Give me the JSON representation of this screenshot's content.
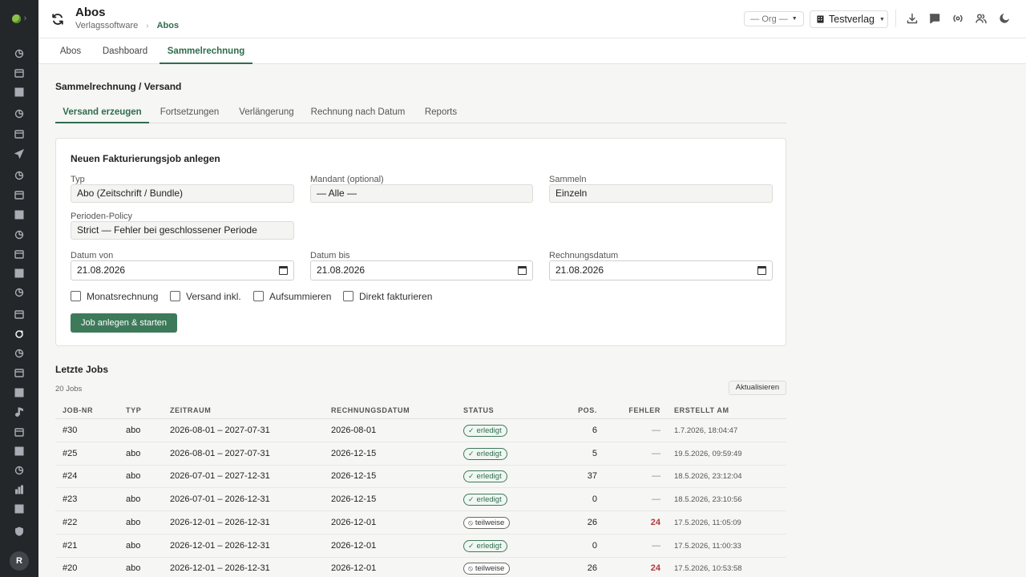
{
  "sidebar": {
    "chevron": "›",
    "items": [
      "chart-pie-icon",
      "calendar-icon",
      "dashboard-icon",
      "users-edit-icon",
      "inbox-icon",
      "send-icon",
      "lightbulb-icon",
      "books-icon",
      "image-icon",
      "briefcase-icon",
      "newspaper-icon",
      "receipt-icon",
      "feather-icon",
      "card-icon",
      "refresh-icon",
      "bag-icon",
      "megaphone-icon",
      "cash-icon",
      "music-icon",
      "document-icon",
      "box-icon",
      "truck-icon",
      "bar-chart-icon",
      "file-icon",
      "shield-icon"
    ],
    "avatar": "R"
  },
  "header": {
    "title": "Abos",
    "breadcrumb": [
      "Verlagssoftware",
      "Abos"
    ],
    "org_select": "— Org —",
    "publisher_select": "Testverlag",
    "icons": [
      "download-icon",
      "chat-icon",
      "broadcast-icon",
      "users-icon",
      "moon-icon"
    ]
  },
  "top_tabs": [
    "Abos",
    "Dashboard",
    "Sammelrechnung"
  ],
  "top_tab_active": "Sammelrechnung",
  "section": {
    "title": "Sammelrechnung / Versand",
    "tabs": [
      "Versand erzeugen",
      "Fortsetzungen",
      "Verlängerung",
      "Rechnung nach Datum",
      "Reports"
    ],
    "active_tab": "Versand erzeugen"
  },
  "form": {
    "title": "Neuen Fakturierungsjob anlegen",
    "typ_label": "Typ",
    "typ_value": "Abo (Zeitschrift / Bundle)",
    "mandant_label": "Mandant (optional)",
    "mandant_value": "— Alle —",
    "sammeln_label": "Sammeln",
    "sammeln_value": "Einzeln",
    "policy_label": "Perioden-Policy",
    "policy_value": "Strict — Fehler bei geschlossener Periode",
    "datum_von_label": "Datum von",
    "datum_von_value": "21.08.2026",
    "datum_bis_label": "Datum bis",
    "datum_bis_value": "21.08.2026",
    "rechnungsdatum_label": "Rechnungsdatum",
    "rechnungsdatum_value": "21.08.2026",
    "checkboxes": [
      "Monatsrechnung",
      "Versand inkl.",
      "Aufsummieren",
      "Direkt fakturieren"
    ],
    "submit_label": "Job anlegen & starten"
  },
  "jobs": {
    "title": "Letzte Jobs",
    "count": "20 Jobs",
    "refresh_label": "Aktualisieren",
    "columns": [
      "Job-Nr",
      "Typ",
      "Zeitraum",
      "Rechnungsdatum",
      "Status",
      "Pos.",
      "Fehler",
      "Erstellt am"
    ],
    "rows": [
      {
        "nr": "#30",
        "typ": "abo",
        "zeitraum": "2026-08-01 – 2027-07-31",
        "rechnungsdatum": "2026-08-01",
        "status": "erledigt",
        "status_kind": "ok",
        "pos": "6",
        "fehler": "—",
        "erstellt": "1.7.2026, 18:04:47"
      },
      {
        "nr": "#25",
        "typ": "abo",
        "zeitraum": "2026-08-01 – 2027-07-31",
        "rechnungsdatum": "2026-12-15",
        "status": "erledigt",
        "status_kind": "ok",
        "pos": "5",
        "fehler": "—",
        "erstellt": "19.5.2026, 09:59:49"
      },
      {
        "nr": "#24",
        "typ": "abo",
        "zeitraum": "2026-07-01 – 2027-12-31",
        "rechnungsdatum": "2026-12-15",
        "status": "erledigt",
        "status_kind": "ok",
        "pos": "37",
        "fehler": "—",
        "erstellt": "18.5.2026, 23:12:04"
      },
      {
        "nr": "#23",
        "typ": "abo",
        "zeitraum": "2026-07-01 – 2026-12-31",
        "rechnungsdatum": "2026-12-15",
        "status": "erledigt",
        "status_kind": "ok",
        "pos": "0",
        "fehler": "—",
        "erstellt": "18.5.2026, 23:10:56"
      },
      {
        "nr": "#22",
        "typ": "abo",
        "zeitraum": "2026-12-01 – 2026-12-31",
        "rechnungsdatum": "2026-12-01",
        "status": "teilweise",
        "status_kind": "partial",
        "pos": "26",
        "fehler": "24",
        "erstellt": "17.5.2026, 11:05:09"
      },
      {
        "nr": "#21",
        "typ": "abo",
        "zeitraum": "2026-12-01 – 2026-12-31",
        "rechnungsdatum": "2026-12-01",
        "status": "erledigt",
        "status_kind": "ok",
        "pos": "0",
        "fehler": "—",
        "erstellt": "17.5.2026, 11:00:33"
      },
      {
        "nr": "#20",
        "typ": "abo",
        "zeitraum": "2026-12-01 – 2026-12-31",
        "rechnungsdatum": "2026-12-01",
        "status": "teilweise",
        "status_kind": "partial",
        "pos": "26",
        "fehler": "24",
        "erstellt": "17.5.2026, 10:53:58"
      }
    ]
  },
  "colors": {
    "accent": "#2f6d4e",
    "primary_button": "#3d7a5a",
    "sidebar_bg": "#23272a",
    "error": "#b03a3a"
  }
}
